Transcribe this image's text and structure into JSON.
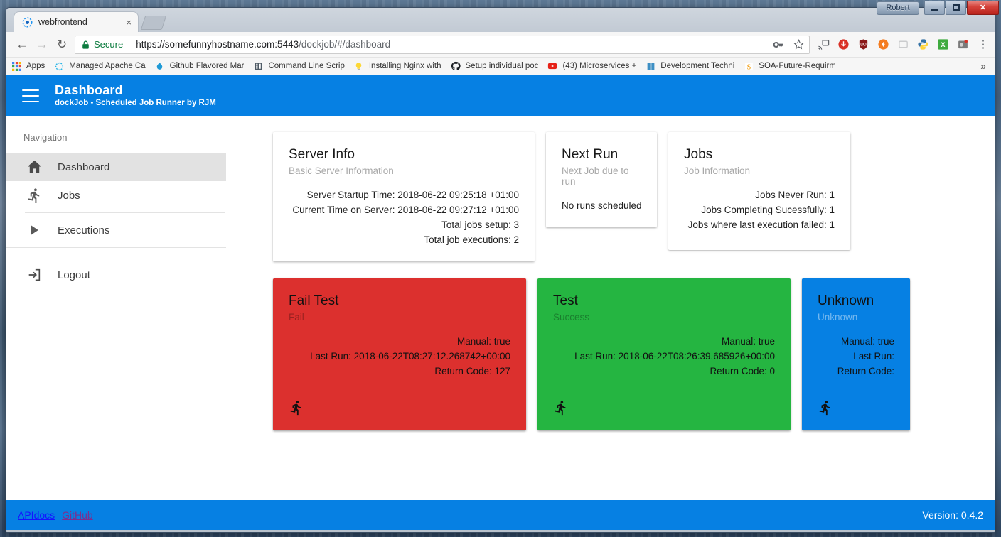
{
  "os": {
    "user_button": "Robert",
    "window_controls": {
      "minimize": "minimize-icon",
      "maximize": "maximize-icon",
      "close": "close-icon"
    }
  },
  "browser": {
    "tab": {
      "title": "webfrontend",
      "favicon": "webfrontend-favicon",
      "close": "×"
    },
    "nav": {
      "back": "←",
      "forward": "→",
      "reload": "↻"
    },
    "omnibox": {
      "secure_label": "Secure",
      "url_host": "https://somefunnyhostname.com:5443",
      "url_path": "/dockjob/#/dashboard",
      "url_full": "https://somefunnyhostname.com:5443/dockjob/#/dashboard"
    },
    "toolbar_icons": [
      "key-icon",
      "star-icon",
      "cast-icon",
      "download-manager-icon",
      "ublock-shield-icon",
      "orange-circle-extension-icon",
      "faded-extension-icon",
      "python-icon",
      "xmarks-icon",
      "screenshot-extension-icon",
      "chrome-menu-icon"
    ],
    "bookmarks": [
      {
        "label": "Apps",
        "icon": "apps-grid-icon"
      },
      {
        "label": "Managed Apache Ca",
        "icon": "dotted-circle-icon"
      },
      {
        "label": "Github Flavored Mar",
        "icon": "drupal-droplet-icon"
      },
      {
        "label": "Command Line Scrip",
        "icon": "document-icon"
      },
      {
        "label": "Installing Nginx with",
        "icon": "lightbulb-icon"
      },
      {
        "label": "Setup individual poc",
        "icon": "github-icon"
      },
      {
        "label": "(43) Microservices +",
        "icon": "youtube-icon"
      },
      {
        "label": "Development Techni",
        "icon": "blue-book-icon"
      },
      {
        "label": "SOA-Future-Requirm",
        "icon": "dollar-icon"
      }
    ],
    "bookmarks_overflow": "»"
  },
  "app": {
    "header": {
      "title": "Dashboard",
      "subtitle": "dockJob - Scheduled Job Runner by RJM",
      "menu_icon": "hamburger-icon"
    },
    "sidebar": {
      "section_label": "Navigation",
      "items": [
        {
          "label": "Dashboard",
          "icon": "home-icon",
          "active": true
        },
        {
          "label": "Jobs",
          "icon": "runner-icon",
          "active": false
        },
        {
          "label": "Executions",
          "icon": "play-triangle-icon",
          "active": false
        },
        {
          "label": "Logout",
          "icon": "logout-icon",
          "active": false
        }
      ]
    },
    "cards": {
      "server_info": {
        "title": "Server Info",
        "subtitle": "Basic Server Information",
        "lines": [
          "Server Startup Time: 2018-06-22 09:25:18 +01:00",
          "Current Time on Server: 2018-06-22 09:27:12 +01:00",
          "Total jobs setup: 3",
          "Total job executions: 2"
        ]
      },
      "next_run": {
        "title": "Next Run",
        "subtitle": "Next Job due to run",
        "lines": [
          "No runs scheduled"
        ]
      },
      "jobs": {
        "title": "Jobs",
        "subtitle": "Job Information",
        "lines": [
          "Jobs Never Run: 1",
          "Jobs Completing Sucessfully: 1",
          "Jobs where last execution failed: 1"
        ]
      }
    },
    "job_cards": [
      {
        "title": "Fail Test",
        "status": "Fail",
        "color": "#DC302E",
        "lines": [
          "Manual: true",
          "Last Run: 2018-06-22T08:27:12.268742+00:00",
          "Return Code: 127"
        ],
        "action_icon": "runner-icon"
      },
      {
        "title": "Test",
        "status": "Success",
        "color": "#25B541",
        "lines": [
          "Manual: true",
          "Last Run: 2018-06-22T08:26:39.685926+00:00",
          "Return Code: 0"
        ],
        "action_icon": "runner-icon"
      },
      {
        "title": "Unknown",
        "status": "Unknown",
        "color": "#0680E3",
        "lines": [
          "Manual: true",
          "Last Run:",
          "Return Code:"
        ],
        "action_icon": "runner-icon"
      }
    ],
    "footer": {
      "api_docs": "APIdocs",
      "github": "GitHub",
      "version": "Version: 0.4.2"
    },
    "accent_color": "#0680E3"
  }
}
